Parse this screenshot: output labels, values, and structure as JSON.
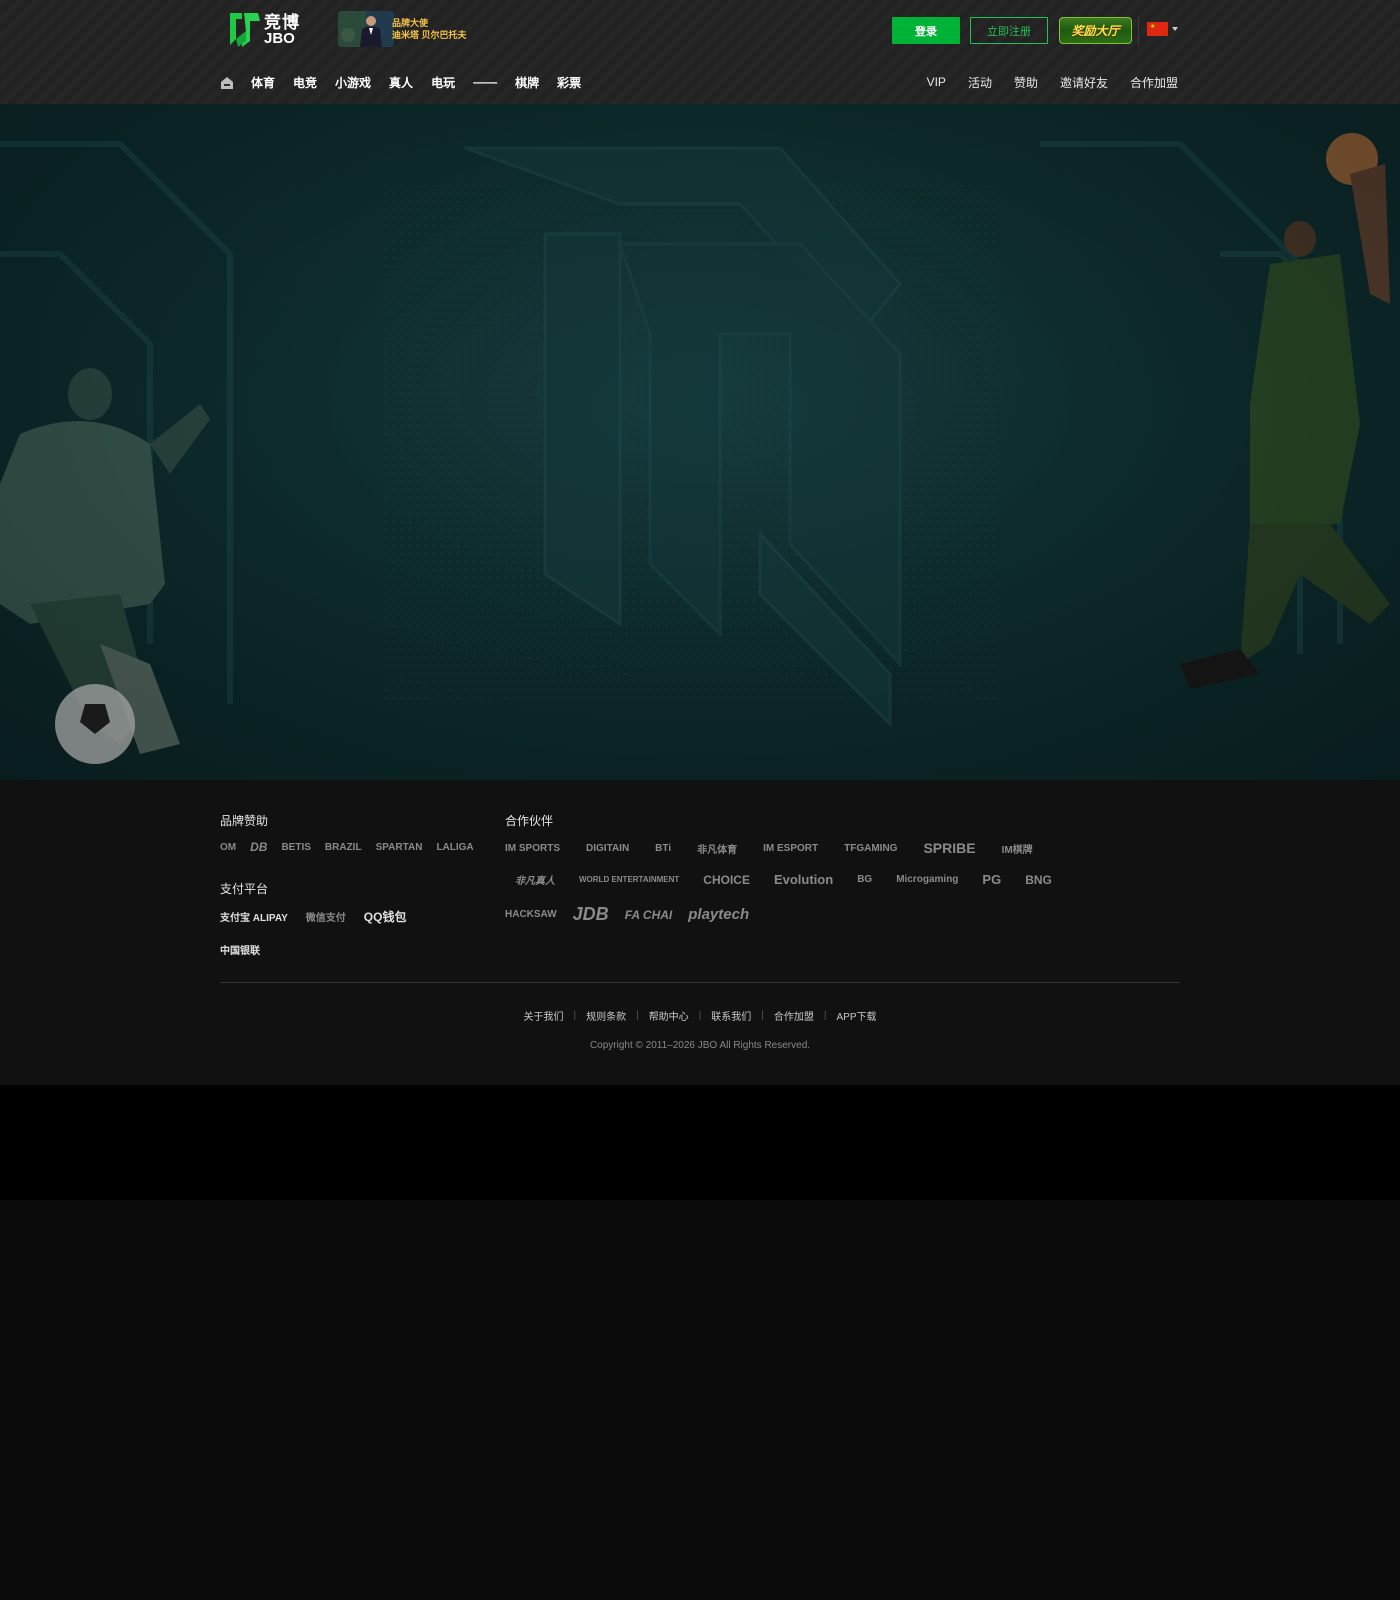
{
  "header": {
    "logo": {
      "cn": "竞博",
      "en": "JBO"
    },
    "ambassador": {
      "line1": "品牌大使",
      "line2": "迪米塔 贝尔巴托夫"
    },
    "login_label": "登录",
    "register_label": "立即注册",
    "reward_label": "奖励大厅",
    "language": "zh-CN"
  },
  "nav": {
    "left": [
      "体育",
      "电竞",
      "小游戏",
      "真人",
      "电玩",
      "——",
      "棋牌",
      "彩票"
    ],
    "right": [
      "VIP",
      "活动",
      "赞助",
      "邀请好友",
      "合作加盟"
    ]
  },
  "footer": {
    "sponsor_title": "品牌赞助",
    "sponsors": [
      "OM",
      "DB",
      "BETIS",
      "BRAZIL",
      "SPARTAN",
      "LALIGA"
    ],
    "payment_title": "支付平台",
    "payments": [
      "支付宝 ALIPAY",
      "微信支付",
      "QQ钱包",
      "中国银联"
    ],
    "partners_title": "合作伙伴",
    "partners_row1": [
      "IM SPORTS",
      "DIGITAIN",
      "BTi",
      "非凡体育",
      "IM ESPORT",
      "TFGAMING",
      "SPRIBE",
      "IM棋牌"
    ],
    "partners_row2": [
      "非凡真人",
      "WORLD ENTERTAINMENT",
      "CHOICE",
      "Evolution",
      "BG",
      "Microgaming",
      "PG",
      "BNG"
    ],
    "partners_row3": [
      "HACKSAW",
      "JDB",
      "FA CHAI",
      "playtech"
    ],
    "links": [
      "关于我们",
      "规则条款",
      "帮助中心",
      "联系我们",
      "合作加盟",
      "APP下载"
    ],
    "copyright": "Copyright © 2011–2026 JBO All Rights Reserved."
  },
  "colors": {
    "accent_green": "#00b336",
    "header_bg": "#262626",
    "hero_bg": "#0f3032",
    "footer_bg": "#111111"
  }
}
